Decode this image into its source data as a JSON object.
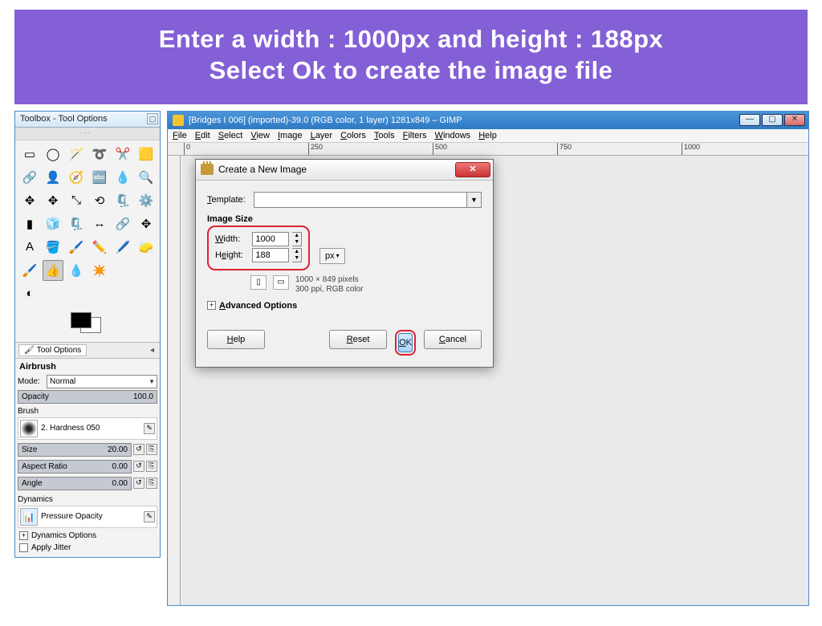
{
  "banner": {
    "line1": "Enter a width : 1000px and height : 188px",
    "line2": "Select Ok to create the image file"
  },
  "toolbox": {
    "title": "Toolbox - Tool Options",
    "tab_label": "Tool Options",
    "current_tool": "Airbrush",
    "mode_label": "Mode:",
    "mode_value": "Normal",
    "opacity_label": "Opacity",
    "opacity_value": "100.0",
    "brush_label": "Brush",
    "brush_name": "2. Hardness 050",
    "size_label": "Size",
    "size_value": "20.00",
    "aspect_label": "Aspect Ratio",
    "aspect_value": "0.00",
    "angle_label": "Angle",
    "angle_value": "0.00",
    "dynamics_label": "Dynamics",
    "dynamics_value": "Pressure Opacity",
    "dyn_options": "Dynamics Options",
    "apply_jitter": "Apply Jitter"
  },
  "gimp": {
    "title": "[Bridges I 006] (imported)-39.0 (RGB color, 1 layer) 1281x849 – GIMP",
    "menu": [
      "File",
      "Edit",
      "Select",
      "View",
      "Image",
      "Layer",
      "Colors",
      "Tools",
      "Filters",
      "Windows",
      "Help"
    ],
    "ruler_ticks": [
      "0",
      "250",
      "500",
      "750",
      "1000"
    ]
  },
  "dialog": {
    "title": "Create a New Image",
    "template_label": "Template:",
    "image_size": "Image Size",
    "width_label": "Width:",
    "width_value": "1000",
    "height_label": "Height:",
    "height_value": "188",
    "unit": "px",
    "info1": "1000 × 849 pixels",
    "info2": "300 ppi, RGB color",
    "advanced": "Advanced Options",
    "help": "Help",
    "reset": "Reset",
    "ok": "OK",
    "cancel": "Cancel"
  },
  "tool_icons": [
    "▭",
    "◯",
    "🪄",
    "➰",
    "✂️",
    "🟨",
    "🔗",
    "👤",
    "🧭",
    "🔤",
    "💧",
    "🔍",
    "✥",
    "✥",
    "⤡",
    "⟲",
    "🗜️",
    "⚙️",
    "▮",
    "🧊",
    "🗜️",
    "↔",
    "🔗",
    "✥",
    "A",
    "🪣",
    "🖌️",
    "✏️",
    "🖊️",
    "🧽",
    "🖌️",
    "👍",
    "💧",
    "✴️",
    "",
    "",
    "◐",
    "",
    ""
  ]
}
